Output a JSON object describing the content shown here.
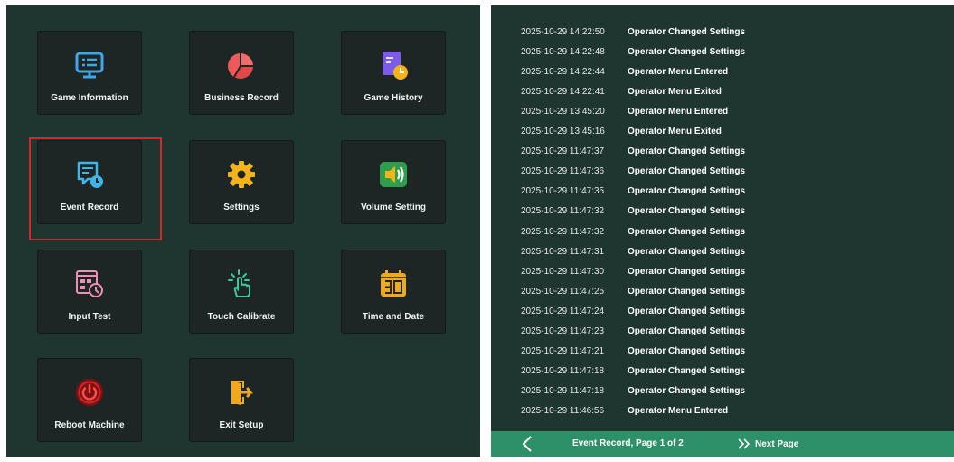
{
  "menu": {
    "tiles": [
      {
        "label": "Game Information",
        "icon": "monitor-icon"
      },
      {
        "label": "Business Record",
        "icon": "pie-chart-icon"
      },
      {
        "label": "Game History",
        "icon": "document-clock-icon"
      },
      {
        "label": "Event Record",
        "icon": "event-record-icon",
        "selected": true
      },
      {
        "label": "Settings",
        "icon": "gear-icon"
      },
      {
        "label": "Volume Setting",
        "icon": "speaker-icon"
      },
      {
        "label": "Input Test",
        "icon": "keypad-test-icon"
      },
      {
        "label": "Touch Calibrate",
        "icon": "touch-hand-icon"
      },
      {
        "label": "Time and Date",
        "icon": "calendar-icon"
      },
      {
        "label": "Reboot Machine",
        "icon": "power-icon"
      },
      {
        "label": "Exit Setup",
        "icon": "exit-door-icon"
      }
    ]
  },
  "log": {
    "entries": [
      {
        "time": "2025-10-29 14:22:50",
        "event": "Operator Changed Settings"
      },
      {
        "time": "2025-10-29 14:22:48",
        "event": "Operator Changed Settings"
      },
      {
        "time": "2025-10-29 14:22:44",
        "event": "Operator Menu Entered"
      },
      {
        "time": "2025-10-29 14:22:41",
        "event": "Operator Menu Exited"
      },
      {
        "time": "2025-10-29 13:45:20",
        "event": "Operator Menu Entered"
      },
      {
        "time": "2025-10-29 13:45:16",
        "event": "Operator Menu Exited"
      },
      {
        "time": "2025-10-29 11:47:37",
        "event": "Operator Changed Settings"
      },
      {
        "time": "2025-10-29 11:47:36",
        "event": "Operator Changed Settings"
      },
      {
        "time": "2025-10-29 11:47:35",
        "event": "Operator Changed Settings"
      },
      {
        "time": "2025-10-29 11:47:32",
        "event": "Operator Changed Settings"
      },
      {
        "time": "2025-10-29 11:47:32",
        "event": "Operator Changed Settings"
      },
      {
        "time": "2025-10-29 11:47:31",
        "event": "Operator Changed Settings"
      },
      {
        "time": "2025-10-29 11:47:30",
        "event": "Operator Changed Settings"
      },
      {
        "time": "2025-10-29 11:47:25",
        "event": "Operator Changed Settings"
      },
      {
        "time": "2025-10-29 11:47:24",
        "event": "Operator Changed Settings"
      },
      {
        "time": "2025-10-29 11:47:23",
        "event": "Operator Changed Settings"
      },
      {
        "time": "2025-10-29 11:47:21",
        "event": "Operator Changed Settings"
      },
      {
        "time": "2025-10-29 11:47:18",
        "event": "Operator Changed Settings"
      },
      {
        "time": "2025-10-29 11:47:18",
        "event": "Operator Changed Settings"
      },
      {
        "time": "2025-10-29 11:46:56",
        "event": "Operator Menu Entered"
      }
    ],
    "footer": {
      "title": "Event Record, Page 1 of 2",
      "next_label": "Next Page",
      "prev_icon": "chevron-left-icon",
      "next_icon": "double-chevron-right-icon"
    }
  },
  "colors": {
    "panel_bg": "#1f3630",
    "tile_bg": "#1d2624",
    "selection": "#d7262a",
    "footer_bg": "#2e9068"
  }
}
